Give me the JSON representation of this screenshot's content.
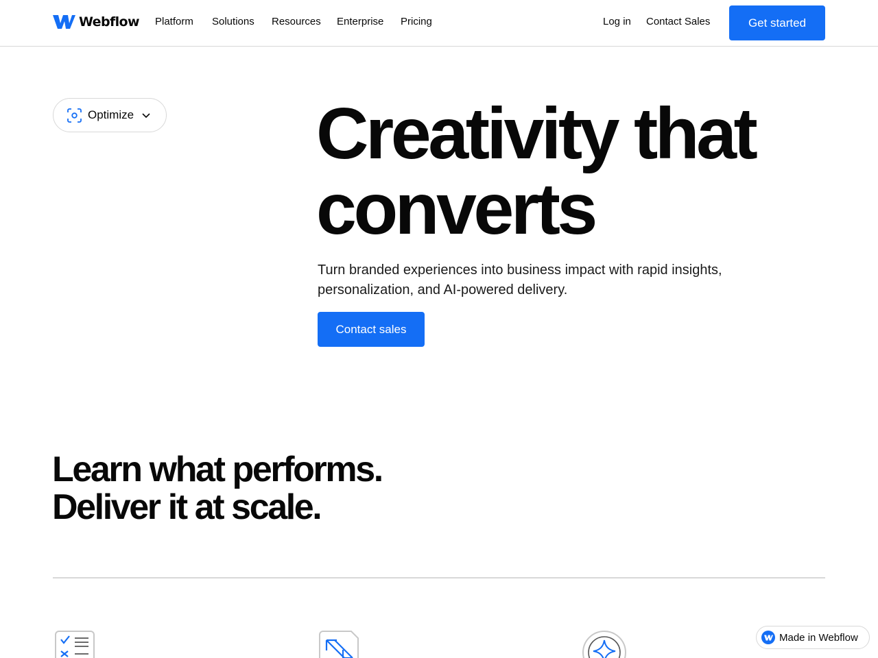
{
  "header": {
    "brand": "Webflow",
    "nav": [
      "Platform",
      "Solutions",
      "Resources",
      "Enterprise",
      "Pricing"
    ],
    "login": "Log in",
    "contact_sales": "Contact Sales",
    "get_started": "Get started"
  },
  "pill": {
    "label": "Optimize",
    "icon": "focus-scan-icon"
  },
  "hero": {
    "title_line1": "Creativity that",
    "title_line2": "converts",
    "subtitle_line1": "Turn branded experiences into business impact with rapid insights,",
    "subtitle_line2": "personalization, and AI-powered delivery.",
    "cta": "Contact sales"
  },
  "section": {
    "title_line1": "Learn what performs.",
    "title_line2": "Deliver it at scale."
  },
  "features": {
    "icons": [
      "checklist-icon",
      "arrows-diagonal-icon",
      "sparkle-icon"
    ]
  },
  "badge": {
    "label": "Made in Webflow"
  },
  "colors": {
    "accent": "#146ef5",
    "text": "#080808",
    "border": "#d8d8d8"
  }
}
